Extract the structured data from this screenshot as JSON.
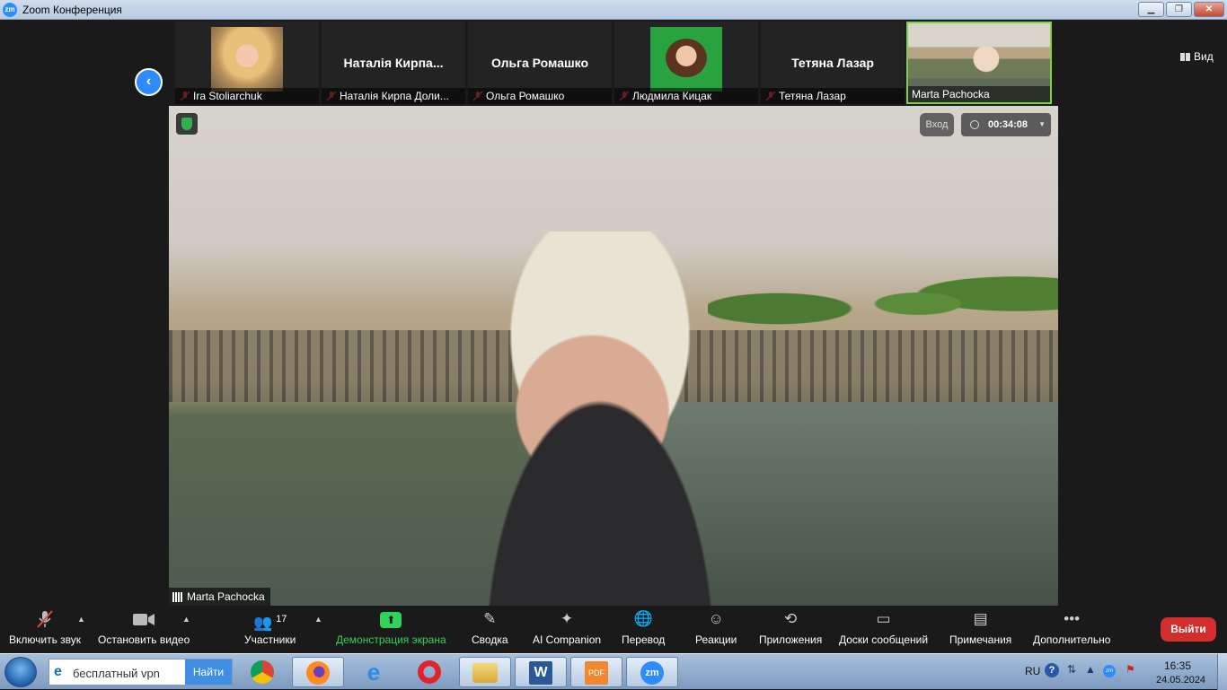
{
  "window": {
    "title": "Zoom Конференция",
    "logo_text": "zm"
  },
  "top_bar": {
    "view_label": "Вид"
  },
  "participants": [
    {
      "display_name": "",
      "label": "Ira Stoliarchuk",
      "muted": true,
      "video": "photo"
    },
    {
      "display_name": "Наталія Кирпа...",
      "label": "Наталія Кирпа Доли...",
      "muted": true,
      "video": "off"
    },
    {
      "display_name": "Ольга Ромашко",
      "label": "Ольга Ромашко",
      "muted": true,
      "video": "off"
    },
    {
      "display_name": "",
      "label": "Людмила Кицак",
      "muted": true,
      "video": "photo"
    },
    {
      "display_name": "Тетяна Лазар",
      "label": "Тетяна Лазар",
      "muted": true,
      "video": "off"
    },
    {
      "display_name": "",
      "label": "Marta Pachocka",
      "muted": false,
      "video": "live",
      "active_speaker": true
    }
  ],
  "main_video": {
    "speaker_name": "Marta Pachocka",
    "enter_label": "Вход",
    "timer": "00:34:08"
  },
  "toolbar": {
    "unmute": "Включить звук",
    "stop_video": "Остановить видео",
    "participants": "Участники",
    "participants_count": "17",
    "share_screen": "Демонстрация экрана",
    "summary": "Сводка",
    "ai_companion": "AI Companion",
    "translate": "Перевод",
    "reactions": "Реакции",
    "apps": "Приложения",
    "whiteboards": "Доски сообщений",
    "notes": "Примечания",
    "more": "Дополнительно",
    "leave": "Выйти"
  },
  "taskbar": {
    "search_value": "бесплатный vpn",
    "search_button": "Найти",
    "apps": [
      "chrome-icon",
      "firefox-icon",
      "internet-explorer-icon",
      "opera-icon",
      "file-explorer-icon",
      "word-icon",
      "pdf-icon",
      "zoom-icon"
    ],
    "word_glyph": "W",
    "pdf_glyph": "PDF",
    "zoom_glyph": "zm",
    "language": "RU",
    "time": "16:35",
    "date": "24.05.2024"
  },
  "colors": {
    "accent_blue": "#2d8cff",
    "share_green": "#2fd35a",
    "leave_red": "#d32d2d",
    "active_border": "#7dd23d"
  }
}
